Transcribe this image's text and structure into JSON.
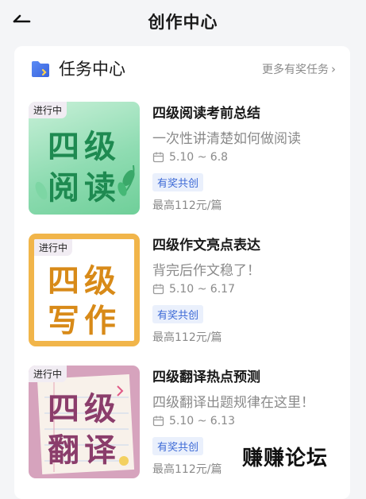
{
  "nav": {
    "title": "创作中心",
    "back_icon": "back-arrow-icon"
  },
  "section": {
    "title": "任务中心",
    "more_label": "更多有奖任务",
    "more_icon": "chevron-right-icon"
  },
  "tasks": [
    {
      "status": "进行中",
      "thumb_text": [
        "四级",
        "阅读"
      ],
      "title": "四级阅读考前总结",
      "subtitle": "一次性讲清楚如何做阅读",
      "date": "5.10 ~ 6.8",
      "badge": "有奖共创",
      "price": "最高112元/篇",
      "thumb_colors": {
        "bg": "#8fdcb2",
        "text": "#1e8a51"
      }
    },
    {
      "status": "进行中",
      "thumb_text": [
        "四级",
        "写作"
      ],
      "title": "四级作文亮点表达",
      "subtitle": "背完后作文稳了！",
      "date": "5.10 ~ 6.17",
      "badge": "有奖共创",
      "price": "最高112元/篇",
      "thumb_colors": {
        "bg": "#f1b54a",
        "text": "#d88a18"
      }
    },
    {
      "status": "进行中",
      "thumb_text": [
        "四级",
        "翻译"
      ],
      "title": "四级翻译热点预测",
      "subtitle": "四级翻译出题规律在这里！",
      "date": "5.10 ~ 6.13",
      "badge": "有奖共创",
      "price": "最高112元/篇",
      "thumb_colors": {
        "bg": "#d6a3bd",
        "text": "#8b3d6b"
      }
    }
  ],
  "watermark": "赚赚论坛"
}
